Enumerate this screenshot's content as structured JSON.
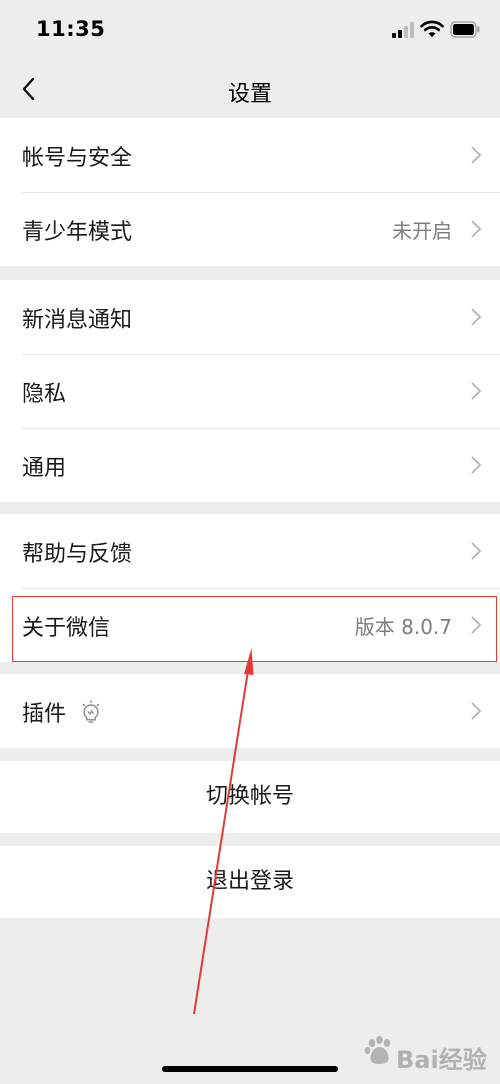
{
  "status_bar": {
    "time": "11:35"
  },
  "nav": {
    "title": "设置"
  },
  "groups": [
    [
      {
        "label": "帐号与安全",
        "value": ""
      },
      {
        "label": "青少年模式",
        "value": "未开启"
      }
    ],
    [
      {
        "label": "新消息通知",
        "value": ""
      },
      {
        "label": "隐私",
        "value": ""
      },
      {
        "label": "通用",
        "value": ""
      }
    ],
    [
      {
        "label": "帮助与反馈",
        "value": ""
      },
      {
        "label": "关于微信",
        "value": "版本 8.0.7"
      }
    ],
    [
      {
        "label": "插件",
        "value": "",
        "icon": "bulb-icon"
      }
    ]
  ],
  "actions": {
    "switch_account": "切换帐号",
    "logout": "退出登录"
  },
  "watermark": {
    "text": "Bai经验"
  },
  "colors": {
    "background": "#ededed",
    "cell": "#ffffff",
    "annotation": "#e53935",
    "secondary_text": "#7d7d7d"
  }
}
